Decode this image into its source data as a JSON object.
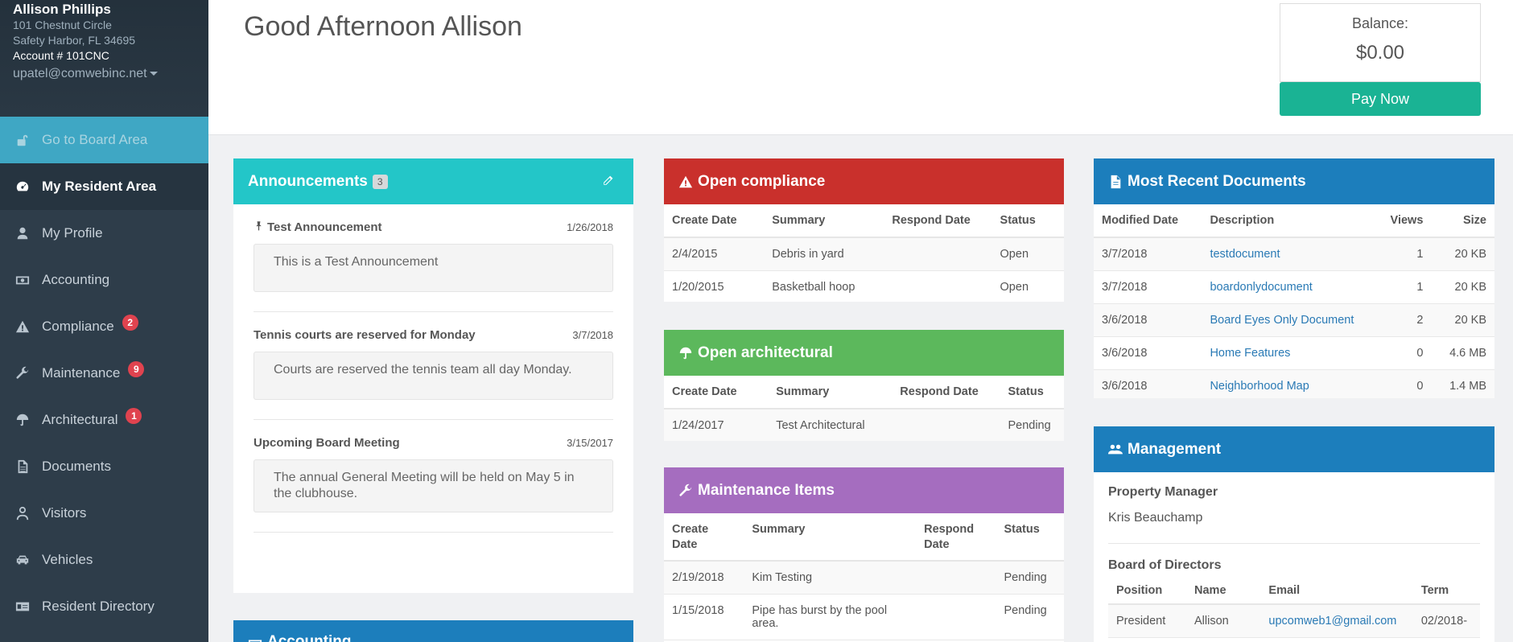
{
  "user": {
    "name": "Allison Phillips",
    "address1": "101 Chestnut Circle",
    "address2": "Safety Harbor, FL 34695",
    "account": "Account # 101CNC",
    "email": "upatel@comwebinc.net"
  },
  "nav": {
    "board": "Go to Board Area",
    "items": [
      {
        "label": "My Resident Area",
        "icon": "dashboard-icon"
      },
      {
        "label": "My Profile",
        "icon": "user-icon"
      },
      {
        "label": "Accounting",
        "icon": "money-icon"
      },
      {
        "label": "Compliance",
        "icon": "warning-icon",
        "badge": "2"
      },
      {
        "label": "Maintenance",
        "icon": "wrench-icon",
        "badge": "9"
      },
      {
        "label": "Architectural",
        "icon": "umbrella-icon",
        "badge": "1"
      },
      {
        "label": "Documents",
        "icon": "document-icon"
      },
      {
        "label": "Visitors",
        "icon": "person-outline-icon"
      },
      {
        "label": "Vehicles",
        "icon": "car-icon"
      },
      {
        "label": "Resident Directory",
        "icon": "id-card-icon"
      }
    ]
  },
  "header": {
    "greeting": "Good Afternoon Allison",
    "balance_label": "Balance:",
    "balance_value": "$0.00",
    "pay_label": "Pay Now"
  },
  "announcements": {
    "title": "Announcements",
    "count": "3",
    "items": [
      {
        "title": "Test Announcement",
        "date": "1/26/2018",
        "body": "This is a Test Announcement"
      },
      {
        "title": "Tennis courts are reserved for Monday",
        "date": "3/7/2018",
        "body": "Courts are reserved the tennis team all day Monday."
      },
      {
        "title": "Upcoming Board Meeting",
        "date": "3/15/2017",
        "body": "The annual General Meeting will be held on May 5 in the clubhouse."
      }
    ]
  },
  "accounting_panel": {
    "title": "Accounting"
  },
  "compliance": {
    "title": "Open compliance",
    "headers": [
      "Create Date",
      "Summary",
      "Respond Date",
      "Status"
    ],
    "rows": [
      [
        "2/4/2015",
        "Debris in yard",
        "",
        "Open"
      ],
      [
        "1/20/2015",
        "Basketball hoop",
        "",
        "Open"
      ]
    ]
  },
  "architectural": {
    "title": "Open architectural",
    "headers": [
      "Create Date",
      "Summary",
      "Respond Date",
      "Status"
    ],
    "rows": [
      [
        "1/24/2017",
        "Test Architectural",
        "",
        "Pending"
      ]
    ]
  },
  "maintenance": {
    "title": "Maintenance Items",
    "headers": [
      "Create Date",
      "Summary",
      "Respond Date",
      "Status"
    ],
    "rows": [
      [
        "2/19/2018",
        "Kim Testing",
        "",
        "Pending"
      ],
      [
        "1/15/2018",
        "Pipe has burst by the pool area.",
        "",
        "Pending"
      ]
    ]
  },
  "documents": {
    "title": "Most Recent Documents",
    "headers": [
      "Modified Date",
      "Description",
      "Views",
      "Size"
    ],
    "rows": [
      [
        "3/7/2018",
        "testdocument",
        "1",
        "20 KB"
      ],
      [
        "3/7/2018",
        "boardonlydocument",
        "1",
        "20 KB"
      ],
      [
        "3/6/2018",
        "Board Eyes Only Document",
        "2",
        "20 KB"
      ],
      [
        "3/6/2018",
        "Home Features",
        "0",
        "4.6 MB"
      ],
      [
        "3/6/2018",
        "Neighborhood Map",
        "0",
        "1.4 MB"
      ]
    ]
  },
  "management": {
    "title": "Management",
    "pm_label": "Property Manager",
    "pm_name": "Kris Beauchamp",
    "board_label": "Board of Directors",
    "board_headers": [
      "Position",
      "Name",
      "Email",
      "Term"
    ],
    "board_rows": [
      [
        "President",
        "Allison",
        "upcomweb1@gmail.com",
        "02/2018-"
      ]
    ]
  },
  "colors": {
    "sidebar": "#2e3d4a",
    "teal": "#23c6c8",
    "red": "#c9302c",
    "green": "#5cb85c",
    "purple": "#a56dbf",
    "blue": "#1c7ebc",
    "pay": "#1ab394"
  }
}
